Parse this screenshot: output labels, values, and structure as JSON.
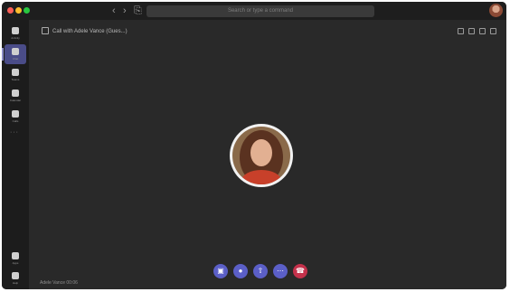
{
  "window": {
    "nav_back": "‹",
    "nav_forward": "›",
    "nav_compose": "⎘",
    "search_placeholder": "Search or type a command"
  },
  "sidebar": {
    "items": [
      {
        "name": "activity",
        "label": "Activity",
        "icon": "bell-icon"
      },
      {
        "name": "chat",
        "label": "Chat",
        "icon": "chat-icon"
      },
      {
        "name": "teams",
        "label": "Teams",
        "icon": "teams-icon"
      },
      {
        "name": "calendar",
        "label": "Calendar",
        "icon": "calendar-icon"
      },
      {
        "name": "calls",
        "label": "Calls",
        "icon": "phone-icon"
      }
    ],
    "more_glyph": "···",
    "bottom_items": [
      {
        "name": "apps",
        "label": "Apps",
        "icon": "apps-icon"
      },
      {
        "name": "help",
        "label": "Help",
        "icon": "help-icon"
      }
    ]
  },
  "call": {
    "title": "Call with Adele Vance (Gues...) ",
    "duration_label": "00:06",
    "status_text": "Adele Vance"
  },
  "controls": [
    {
      "name": "camera-button",
      "icon": "camera-icon",
      "glyph": "▣"
    },
    {
      "name": "mic-button",
      "icon": "mic-icon",
      "glyph": "●"
    },
    {
      "name": "share-button",
      "icon": "share-icon",
      "glyph": "⇧"
    },
    {
      "name": "more-button",
      "icon": "more-icon",
      "glyph": "⋯"
    },
    {
      "name": "hangup-button",
      "icon": "phone-hangup-icon",
      "glyph": "☎"
    }
  ],
  "colors": {
    "accent": "#5b5fc7",
    "hangup": "#c4314b",
    "background": "#292929"
  }
}
